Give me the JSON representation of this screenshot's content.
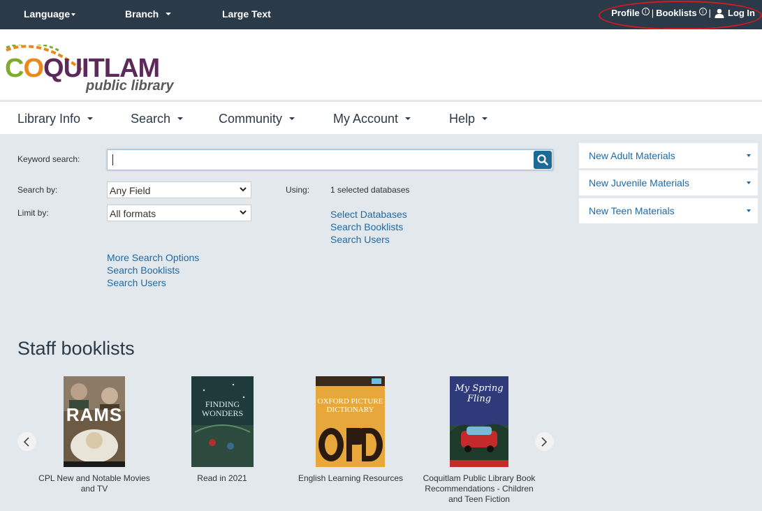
{
  "topbar": {
    "language": "Language",
    "branch": "Branch",
    "large_text": "Large Text",
    "profile": "Profile",
    "booklists": "Booklists",
    "login": "Log In",
    "separator": "|"
  },
  "logo": {
    "name": "COQUITLAM",
    "subtitle": "public library"
  },
  "nav": {
    "library_info": "Library Info",
    "search": "Search",
    "community": "Community",
    "my_account": "My Account",
    "help": "Help"
  },
  "search": {
    "keyword_label": "Keyword search:",
    "keyword_value": "",
    "search_by_label": "Search by:",
    "search_by_value": "Any Field",
    "limit_by_label": "Limit by:",
    "limit_by_value": "All formats",
    "using_label": "Using:",
    "using_value": "1 selected databases",
    "links_right": [
      "Select Databases",
      "Search Booklists",
      "Search Users"
    ],
    "links_left": [
      "More Search Options",
      "Search Booklists",
      "Search Users"
    ]
  },
  "right_panel": [
    "New Adult Materials",
    "New Juvenile Materials",
    "New Teen Materials"
  ],
  "booklists": {
    "title": "Staff booklists",
    "items": [
      {
        "caption": "CPL New and Notable Movies and TV",
        "cover_text": "RAMS"
      },
      {
        "caption": "Read in 2021",
        "cover_text": "FINDING WONDERS"
      },
      {
        "caption": "English Learning Resources",
        "cover_text": "OXFORD PICTURE DICTIONARY"
      },
      {
        "caption": "Coquitlam Public Library Book Recommendations - Children and Teen Fiction",
        "cover_text": "My Spring Fling"
      }
    ]
  },
  "colors": {
    "topbar": "#2b3a48",
    "link": "#1e6aa8",
    "search_button": "#1e6a96",
    "annotation": "#d8181e"
  }
}
